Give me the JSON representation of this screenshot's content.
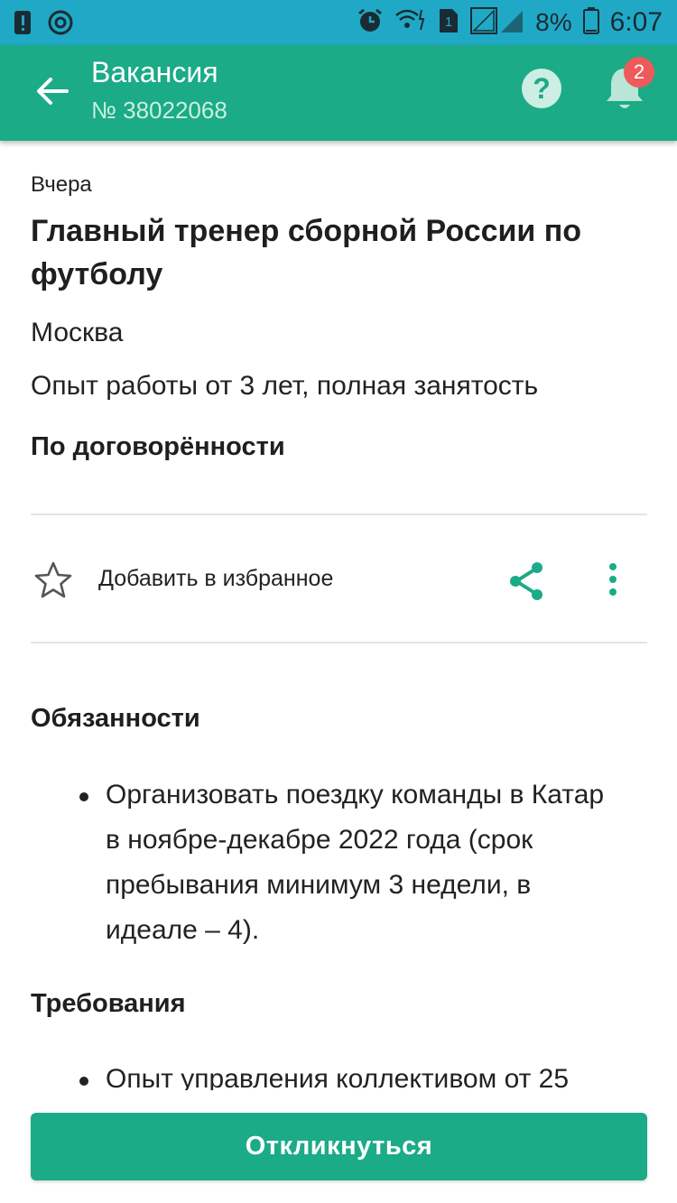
{
  "status_bar": {
    "battery_percent": "8%",
    "time": "6:07",
    "sim_slot": "1",
    "icons": [
      "alert-icon",
      "sync-icon",
      "alarm-icon",
      "wifi-icon",
      "sim-icon",
      "signal-icon",
      "battery-icon"
    ]
  },
  "app_bar": {
    "title": "Вакансия",
    "subtitle": "№ 38022068",
    "help_label": "?",
    "notifications_count": "2",
    "colors": {
      "primary": "#1bab86",
      "status_bar": "#1fa9c6",
      "badge": "#ee5a5a"
    }
  },
  "vacancy": {
    "date": "Вчера",
    "title": "Главный тренер сборной России по футболу",
    "city": "Москва",
    "experience": "Опыт работы от 3 лет, полная занятость",
    "salary": "По договорённости"
  },
  "actions": {
    "favorite_label": "Добавить в избранное"
  },
  "sections": {
    "duties": {
      "heading": "Обязанности",
      "items": [
        "Организовать поездку команды в Катар в ноябре-декабре 2022 года (срок пребывания минимум 3 недели, в идеале – 4)."
      ]
    },
    "requirements": {
      "heading": "Требования",
      "items": [
        "Опыт управления коллективом от 25"
      ]
    }
  },
  "footer": {
    "apply_label": "Откликнуться"
  }
}
